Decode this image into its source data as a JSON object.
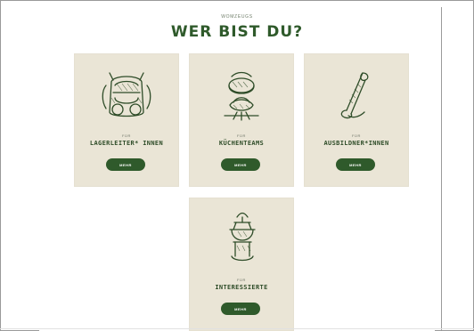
{
  "header": {
    "kicker": "WOMZEUGS",
    "title": "WER BIST DU?"
  },
  "cards": [
    {
      "for_label": "FÜR",
      "title": "LAGERLEITER* INNEN",
      "button_label": "MEHR",
      "icon_name": "backpack-icon"
    },
    {
      "for_label": "FÜR",
      "title": "KÜCHENTEAMS",
      "button_label": "MEHR",
      "icon_name": "pot-fire-icon"
    },
    {
      "for_label": "FÜR",
      "title": "AUSBILDNER*INNEN",
      "button_label": "MEHR",
      "icon_name": "scroll-icon"
    },
    {
      "for_label": "FÜR",
      "title": "INTERESSIERTE",
      "button_label": "MEHR",
      "icon_name": "lantern-icon"
    }
  ],
  "colors": {
    "accent": "#2f5a2b",
    "card": "#eae5d6",
    "text": "#2e4c28"
  }
}
